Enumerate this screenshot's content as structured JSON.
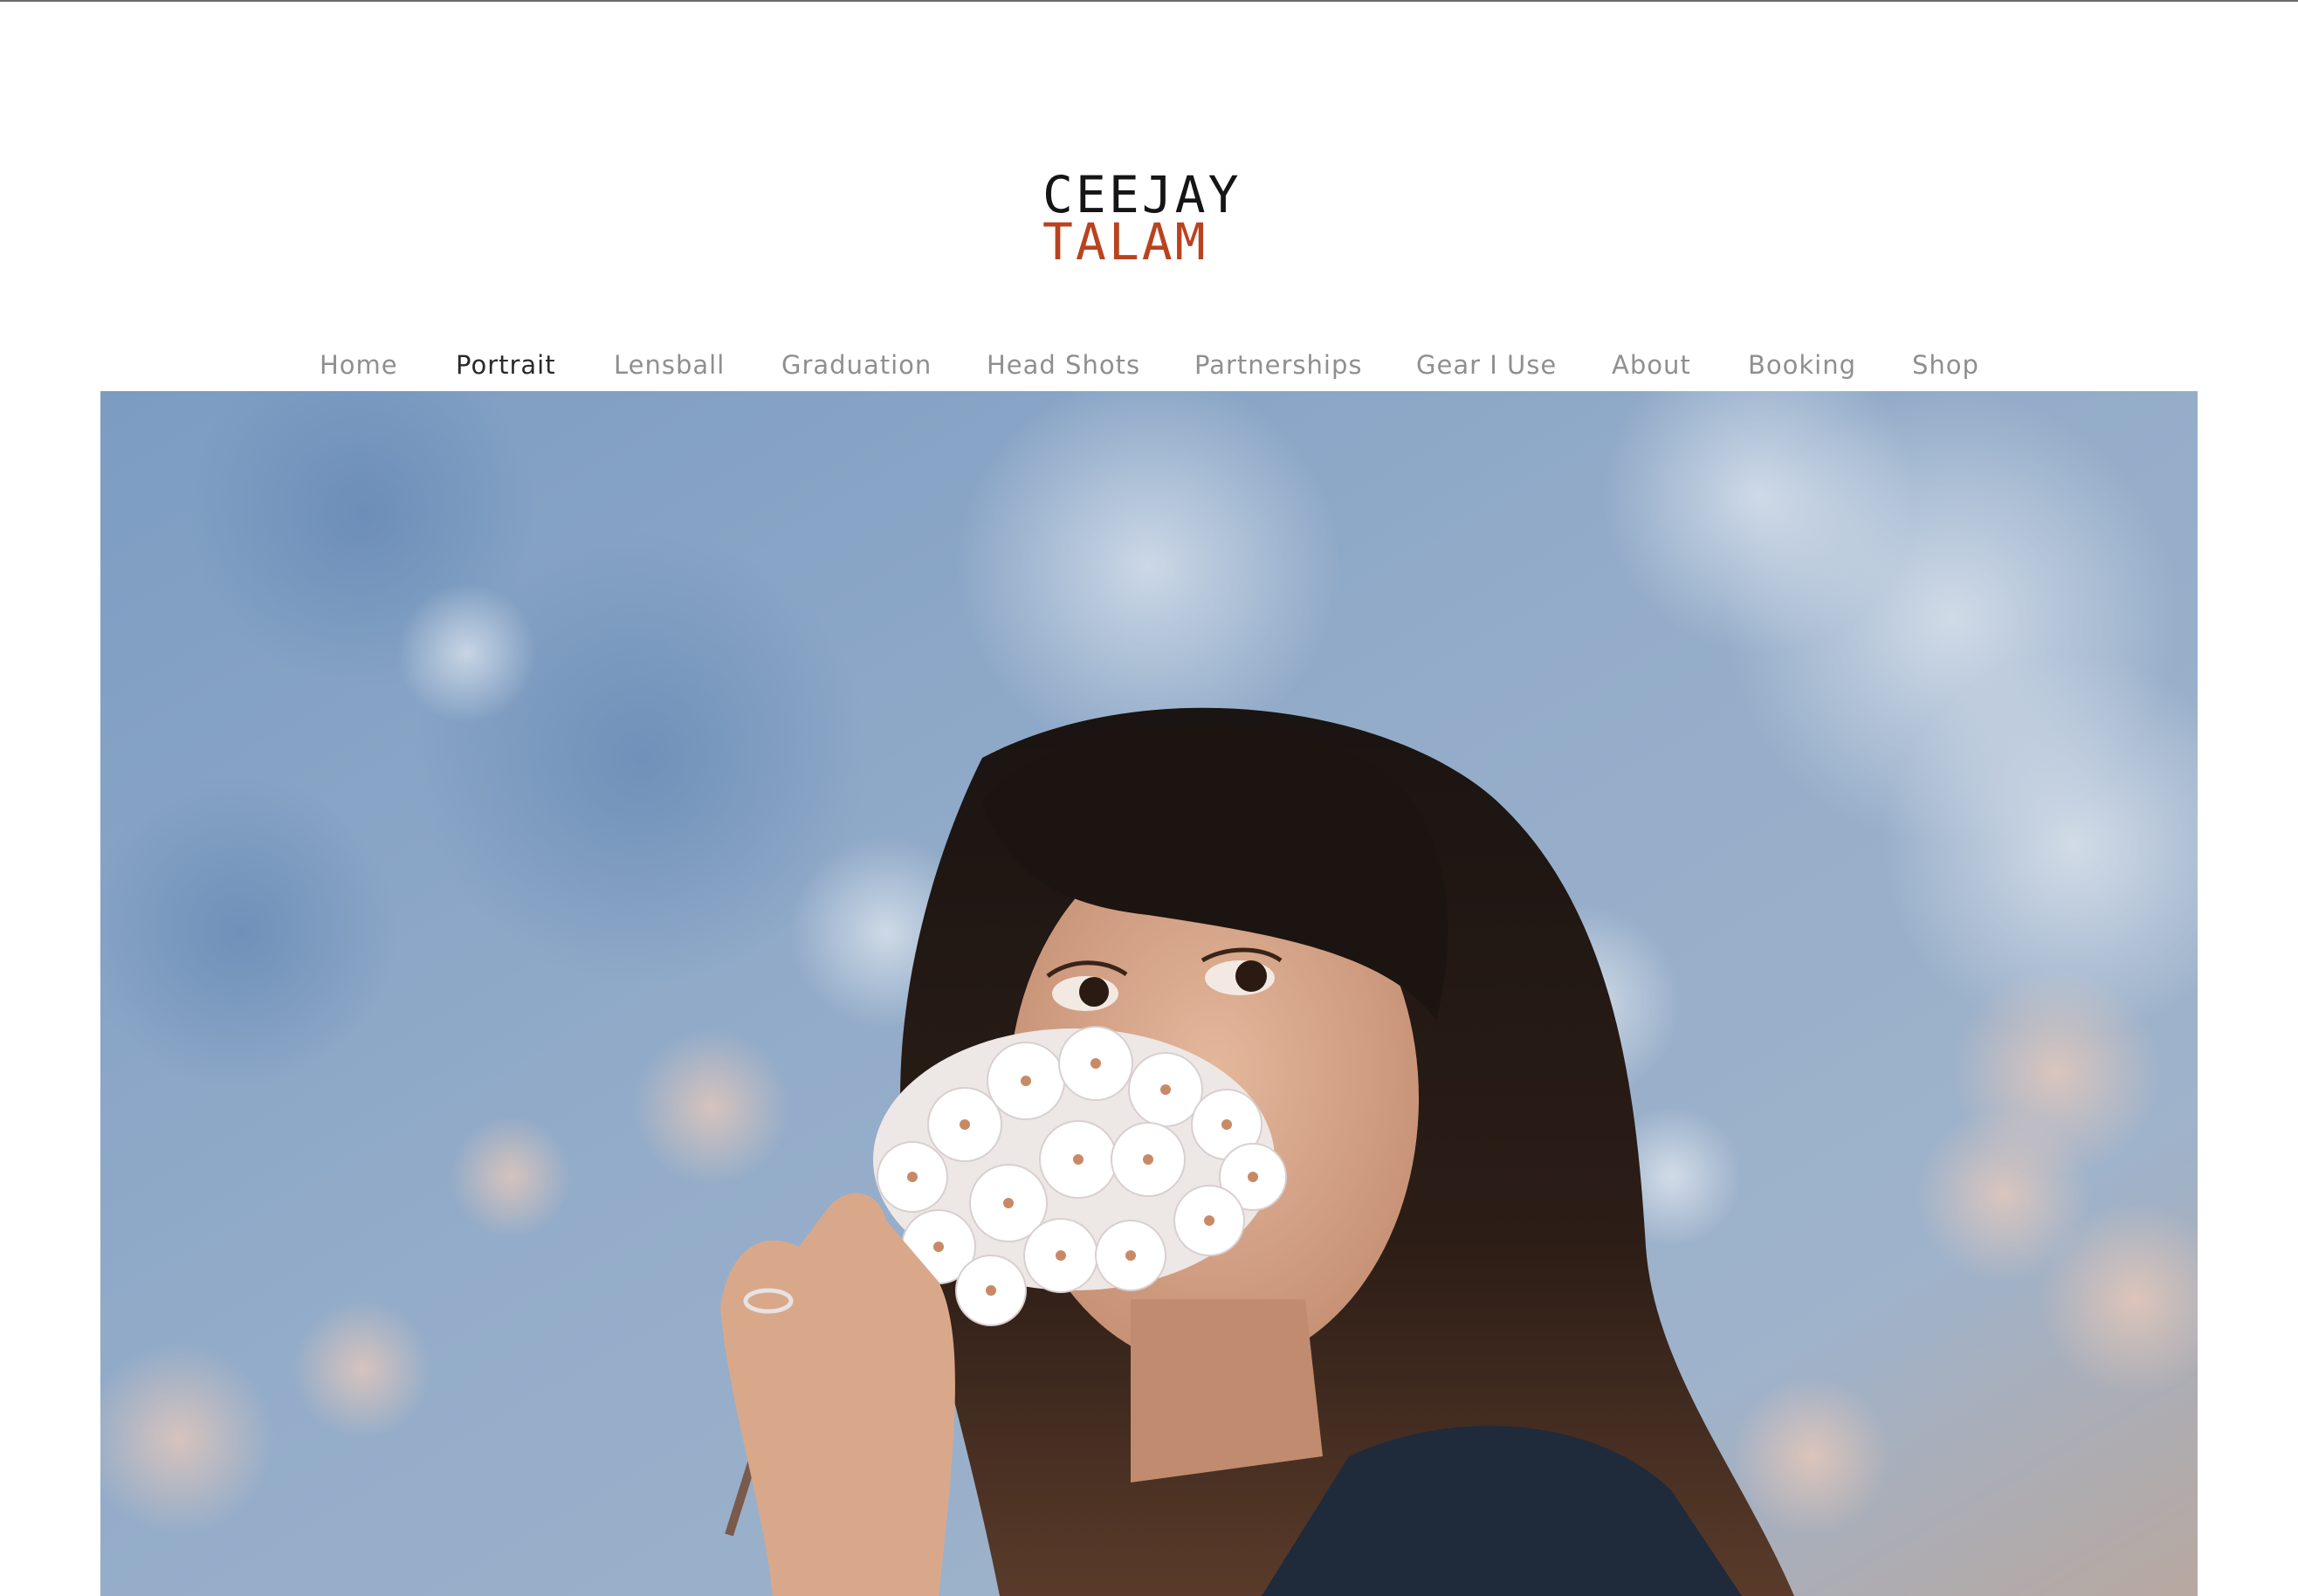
{
  "logo": {
    "line1": "CEEJAY",
    "line2": "TALAM",
    "color_primary": "#151515",
    "color_accent": "#b9431f"
  },
  "nav": {
    "items": [
      {
        "label": "Home",
        "active": false
      },
      {
        "label": "Portrait",
        "active": true
      },
      {
        "label": "Lensball",
        "active": false
      },
      {
        "label": "Graduation",
        "active": false
      },
      {
        "label": "Head Shots",
        "active": false
      },
      {
        "label": "Partnerships",
        "active": false
      },
      {
        "label": "Gear I Use",
        "active": false
      },
      {
        "label": "About",
        "active": false
      },
      {
        "label": "Booking",
        "active": false
      },
      {
        "label": "Shop",
        "active": false
      }
    ],
    "color_inactive": "#8f8f8f",
    "color_active": "#2a2a2a"
  },
  "hero": {
    "subject": "portrait-photo"
  }
}
